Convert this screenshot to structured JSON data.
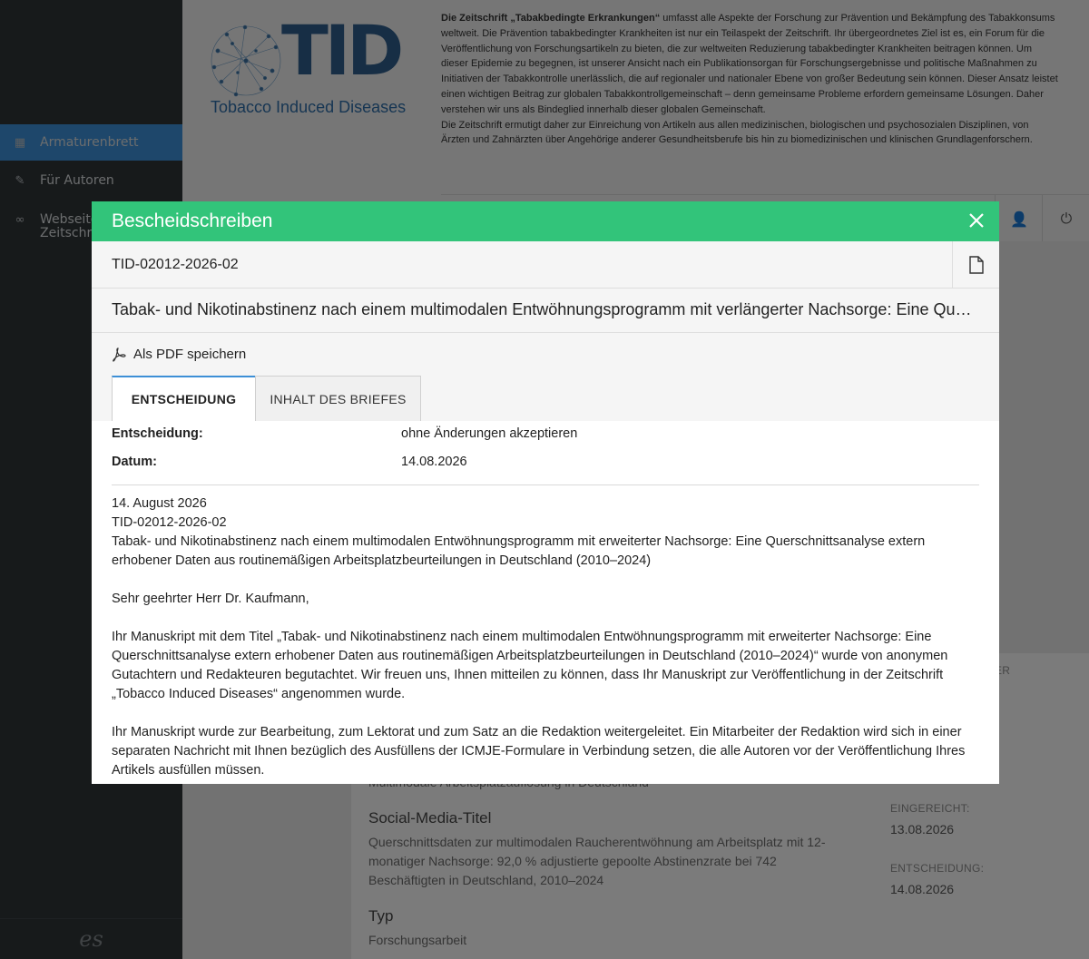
{
  "sidebar": {
    "items": [
      {
        "icon": "grid-icon",
        "label": "Armaturenbrett",
        "active": true
      },
      {
        "icon": "pencil-icon",
        "label": "Für Autoren",
        "active": false
      },
      {
        "icon": "link-icon",
        "label": "Webseite der Zeitschrift",
        "active": false
      }
    ],
    "footer_mark": "es"
  },
  "journal": {
    "logo_text": "TID",
    "logo_subtitle": "Tobacco Induced Diseases",
    "intro_lead": "Die Zeitschrift „Tabakbedingte Erkrankungen“",
    "intro_rest": " umfasst alle Aspekte der Forschung zur Prävention und Bekämpfung des Tabakkonsums weltweit. Die Prävention tabakbedingter Krankheiten ist nur ein Teilaspekt der Zeitschrift. Ihr übergeordnetes Ziel ist es, ein Forum für die Veröffentlichung von Forschungsartikeln zu bieten, die zur weltweiten Reduzierung tabakbedingter Krankheiten beitragen können. Um dieser Epidemie zu begegnen, ist unserer Ansicht nach ein Publikationsorgan für Forschungsergebnisse und politische Maßnahmen zu Initiativen der Tabakkontrolle unerlässlich, die auf regionaler und nationaler Ebene von großer Bedeutung sein können. Dieser Ansatz leistet einen wichtigen Beitrag zur globalen Tabakkontrollgemeinschaft – denn gemeinsame Probleme erfordern gemeinsame Lösungen. Daher verstehen wir uns als Bindeglied innerhalb dieser globalen Gemeinschaft.",
    "intro_second": "Die Zeitschrift ermutigt daher zur Einreichung von Artikeln aus allen medizinischen, biologischen und psychosozialen Disziplinen, von Ärzten und Zahnärzten über Angehörige anderer Gesundheitsberufe bis hin zu biomedizinischen und klinischen Grundlagenforschern."
  },
  "background_panel": {
    "partial_label": "DER",
    "partial_text": "Multimodale Arbeitsplatzauflösung in Deutschland",
    "social_title_label": "Social-Media-Titel",
    "social_title": "Querschnittsdaten zur multimodalen Raucherentwöhnung am Arbeitsplatz mit 12-monatiger Nachsorge: 92,0 % adjustierte gepoolte Abstinenzrate bei 742 Beschäftigten in Deutschland, 2010–2024",
    "type_label": "Typ",
    "type_value": "Forschungsarbeit",
    "submitted_label": "EINGEREICHT:",
    "submitted_value": "13.08.2026",
    "decision_label": "ENTSCHEIDUNG:",
    "decision_value": "14.08.2026"
  },
  "modal": {
    "title": "Bescheidschreiben",
    "manuscript_id": "TID-02012-2026-02",
    "article_title": "Tabak- und Nikotinabstinenz nach einem multimodalen Entwöhnungsprogramm mit verlängerter Nachsorge: Eine Querschnittsanalyse extern erhobener Daten",
    "pdf_label": "Als PDF speichern",
    "tabs": [
      "ENTSCHEIDUNG",
      "INHALT DES BRIEFES"
    ],
    "decision_label": "Entscheidung:",
    "decision_value": "ohne Änderungen akzeptieren",
    "date_label": "Datum:",
    "date_value": "14.08.2026",
    "letter": {
      "date": "14. August 2026",
      "id": "TID-02012-2026-02",
      "title": "Tabak- und Nikotinabstinenz nach einem multimodalen Entwöhnungsprogramm mit erweiterter Nachsorge: Eine Querschnittsanalyse extern erhobener Daten aus routinemäßigen Arbeitsplatzbeurteilungen in Deutschland (2010–2024)",
      "salutation": "Sehr geehrter Herr Dr. Kaufmann,",
      "para1": "Ihr Manuskript mit dem Titel „Tabak- und Nikotinabstinenz nach einem multimodalen Entwöhnungsprogramm mit erweiterter Nachsorge: Eine Querschnittsanalyse extern erhobener Daten aus routinemäßigen Arbeitsplatzbeurteilungen in Deutschland (2010–2024)“ wurde von anonymen Gutachtern und Redakteuren begutachtet. Wir freuen uns, Ihnen mitteilen zu können, dass Ihr Manuskript zur Veröffentlichung in der Zeitschrift „Tobacco Induced Diseases“ angenommen wurde.",
      "para2": "Ihr Manuskript wurde zur Bearbeitung, zum Lektorat und zum Satz an die Redaktion weitergeleitet. Ein Mitarbeiter der Redaktion wird sich in einer separaten Nachricht mit Ihnen bezüglich des Ausfüllens der ICMJE-Formulare in Verbindung setzen, die alle Autoren vor der Veröffentlichung Ihres Artikels ausfüllen müssen."
    }
  },
  "colors": {
    "modal_header": "#32c47a",
    "sidebar": "#2f3437",
    "active_item": "#3d8fd6",
    "logo_blue": "#2e5d8a"
  }
}
